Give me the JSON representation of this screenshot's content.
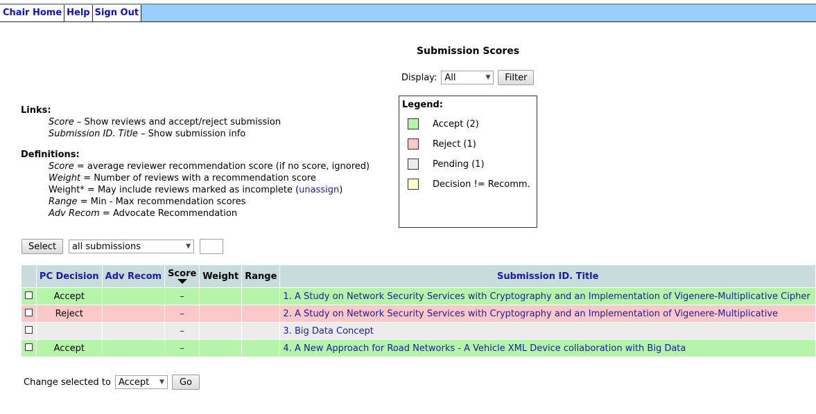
{
  "nav": {
    "items": [
      "Chair Home",
      "Help",
      "Sign Out"
    ]
  },
  "page": {
    "title": "Submission Scores"
  },
  "display": {
    "label": "Display:",
    "selected": "All",
    "filter_button": "Filter"
  },
  "links": {
    "title": "Links:",
    "score_term": "Score",
    "score_desc": " – Show reviews and accept/reject submission",
    "title_term": "Submission ID. Title",
    "title_desc": " – Show submission info"
  },
  "definitions": {
    "title": "Definitions:",
    "score_term": "Score",
    "score_desc": " = average reviewer recommendation score (if no score, ignored)",
    "weight_term": "Weight",
    "weight_desc": " = Number of reviews with a recommendation score",
    "weightstar_prefix": "Weight* = May include reviews marked as incomplete (",
    "weightstar_link": "unassign",
    "weightstar_suffix": ")",
    "range_term": "Range",
    "range_desc": " = Min - Max recommendation scores",
    "adv_term": "Adv Recom",
    "adv_desc": " = Advocate Recommendation"
  },
  "legend": {
    "title": "Legend:",
    "items": [
      {
        "label": "Accept (2)",
        "color": "#b4f5a8"
      },
      {
        "label": "Reject (1)",
        "color": "#fcc8c8"
      },
      {
        "label": "Pending (1)",
        "color": "#ececec"
      },
      {
        "label": "Decision != Recomm.",
        "color": "#ffffcc"
      }
    ]
  },
  "select_bar": {
    "button": "Select",
    "dropdown": "all submissions"
  },
  "table": {
    "headers": {
      "decision": "PC Decision",
      "adv": "Adv Recom",
      "score": "Score",
      "weight": "Weight",
      "range": "Range",
      "title": "Submission ID. Title"
    },
    "rows": [
      {
        "decision": "Accept",
        "adv": "",
        "score": "–",
        "weight": "",
        "range": "",
        "title": "1. A Study on Network Security Services with Cryptography and an Implementation of Vigenere-Multiplicative Cipher"
      },
      {
        "decision": "Reject",
        "adv": "",
        "score": "–",
        "weight": "",
        "range": "",
        "title": "2. A Study on Network Security Services with Cryptography and an Implementation of Vigenere-Multiplicative"
      },
      {
        "decision": "",
        "adv": "",
        "score": "–",
        "weight": "",
        "range": "",
        "title": "3. Big Data Concept"
      },
      {
        "decision": "Accept",
        "adv": "",
        "score": "–",
        "weight": "",
        "range": "",
        "title": "4. A New Approach for Road Networks - A Vehicle XML Device collaboration with Big Data"
      }
    ]
  },
  "change": {
    "label": "Change selected to",
    "selected": "Accept",
    "go_button": "Go"
  }
}
